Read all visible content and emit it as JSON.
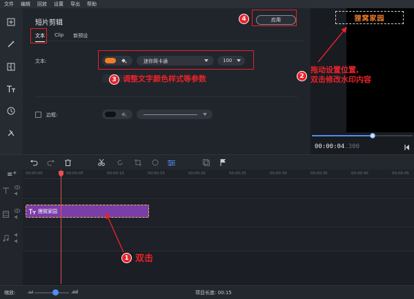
{
  "menu": [
    "文件",
    "编辑",
    "回放",
    "设置",
    "导出",
    "帮助"
  ],
  "editor": {
    "title": "短片剪辑",
    "tabs": [
      "文本",
      "Clip",
      "新预设"
    ],
    "apply_label": "应用",
    "text_label": "文本:",
    "font_name": "迷你简卡通",
    "font_size": "100",
    "border_label": "边框:"
  },
  "colors": {
    "text_color": "#f07f28",
    "accent": "#4f8ef0",
    "clip": "#7a3ea8",
    "annotation": "#e8232a"
  },
  "preview": {
    "watermark": "狸窝家园",
    "time_main": "00:00:04",
    "time_ms": ".300",
    "progress": 0.6
  },
  "ruler": [
    "00:00:00",
    "00:00:05",
    "00:00:10",
    "00:00:15",
    "00:00:20",
    "00:00:25",
    "00:00:30",
    "00:00:35",
    "00:00:40",
    "00:00:45"
  ],
  "clip": {
    "label": "狸窝家园"
  },
  "status": {
    "zoom_label": "缩放:",
    "project_length": "项目长度: 00:15"
  },
  "annotations": {
    "a1": {
      "num": "1",
      "text": "双击"
    },
    "a2": {
      "num": "2",
      "line1": "拖动设置位置,",
      "line2": "双击修改水印内容"
    },
    "a3": {
      "num": "3",
      "text": "调整文字颜色样式等参数"
    },
    "a4": {
      "num": "4"
    }
  }
}
